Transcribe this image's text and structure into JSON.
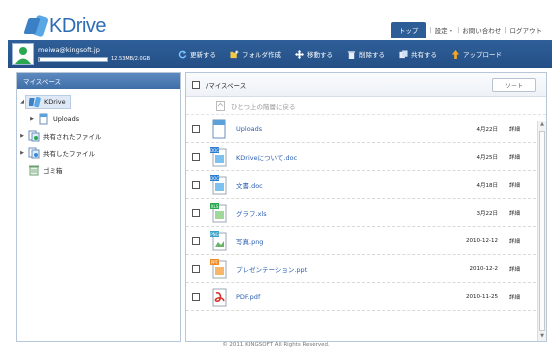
{
  "app": {
    "logo_text": "KDrive"
  },
  "topnav": {
    "top": "トップ",
    "settings": "設定・",
    "contact": "お問い合わせ",
    "logout": "ログアウト",
    "sep": "|"
  },
  "user": {
    "email": "meiwa@kingsoft.jp",
    "quota": "12.53MB/2.0GB",
    "quota_fraction": 0.01
  },
  "toolbar": {
    "refresh": "更新する",
    "new_folder": "フォルダ作成",
    "move": "移動する",
    "delete": "削除する",
    "share": "共有する",
    "upload": "アップロード"
  },
  "left": {
    "title": "マイスペース",
    "tree": [
      {
        "label": "KDrive",
        "icon": "kdrive-icon"
      },
      {
        "label": "Uploads",
        "icon": "folder-icon"
      },
      {
        "label": "共有されたファイル",
        "icon": "shared-in-icon"
      },
      {
        "label": "共有したファイル",
        "icon": "shared-out-icon"
      },
      {
        "label": "ゴミ箱",
        "icon": "trash-icon"
      }
    ]
  },
  "right": {
    "title": "/マイスペース",
    "sort": "ソート",
    "up_label": "ひとつ上の階層に戻る",
    "files": [
      {
        "name": "Uploads",
        "date": "4月22日",
        "detail": "詳細",
        "type": "folder"
      },
      {
        "name": "KDriveについて.doc",
        "date": "4月25日",
        "detail": "詳細",
        "type": "doc"
      },
      {
        "name": "文書.doc",
        "date": "4月18日",
        "detail": "詳細",
        "type": "doc"
      },
      {
        "name": "グラフ.xls",
        "date": "3月22日",
        "detail": "詳細",
        "type": "xls"
      },
      {
        "name": "写真.png",
        "date": "2010-12-12",
        "detail": "詳細",
        "type": "png"
      },
      {
        "name": "プレゼンテーション.ppt",
        "date": "2010-12-2",
        "detail": "詳細",
        "type": "ppt"
      },
      {
        "name": "PDF.pdf",
        "date": "2010-11-25",
        "detail": "詳細",
        "type": "pdf"
      }
    ]
  },
  "footer": {
    "copyright": "© 2011 KINGSOFT All Rights Reserved."
  }
}
